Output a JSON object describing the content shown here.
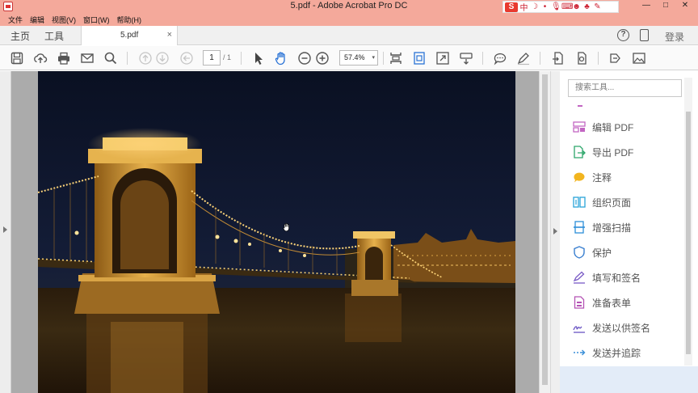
{
  "window": {
    "title": "5.pdf - Adobe Acrobat Pro DC",
    "minimize": "—",
    "maximize": "□",
    "close": "✕"
  },
  "ime": {
    "logo": "S",
    "mode": "中"
  },
  "menu": [
    "文件",
    "编辑",
    "视图(V)",
    "窗口(W)",
    "帮助(H)"
  ],
  "tabs": {
    "home": "主页",
    "tools": "工具",
    "document": "5.pdf",
    "close": "×"
  },
  "header": {
    "help": "?",
    "login": "登录"
  },
  "toolbar": {
    "page_current": "1",
    "page_total": "/ 1",
    "zoom": "57.4%",
    "zoom_caret": "▾"
  },
  "right_panel": {
    "search_placeholder": "搜索工具...",
    "tools": [
      {
        "label": "编辑 PDF",
        "icon": "edit-pdf-icon",
        "color": "#c266c2"
      },
      {
        "label": "导出 PDF",
        "icon": "export-pdf-icon",
        "color": "#2da66b"
      },
      {
        "label": "注释",
        "icon": "comment-icon",
        "color": "#f2b51f"
      },
      {
        "label": "组织页面",
        "icon": "organize-pages-icon",
        "color": "#29a3d8"
      },
      {
        "label": "增强扫描",
        "icon": "enhance-scan-icon",
        "color": "#2d8ed8"
      },
      {
        "label": "保护",
        "icon": "protect-icon",
        "color": "#3a7fd0"
      },
      {
        "label": "填写和签名",
        "icon": "fill-sign-icon",
        "color": "#7a5bc6"
      },
      {
        "label": "准备表单",
        "icon": "prepare-form-icon",
        "color": "#b553b5"
      },
      {
        "label": "发送以供签名",
        "icon": "send-for-signature-icon",
        "color": "#6a55c4"
      },
      {
        "label": "发送并追踪",
        "icon": "send-track-icon",
        "color": "#3a8fd8"
      }
    ]
  }
}
